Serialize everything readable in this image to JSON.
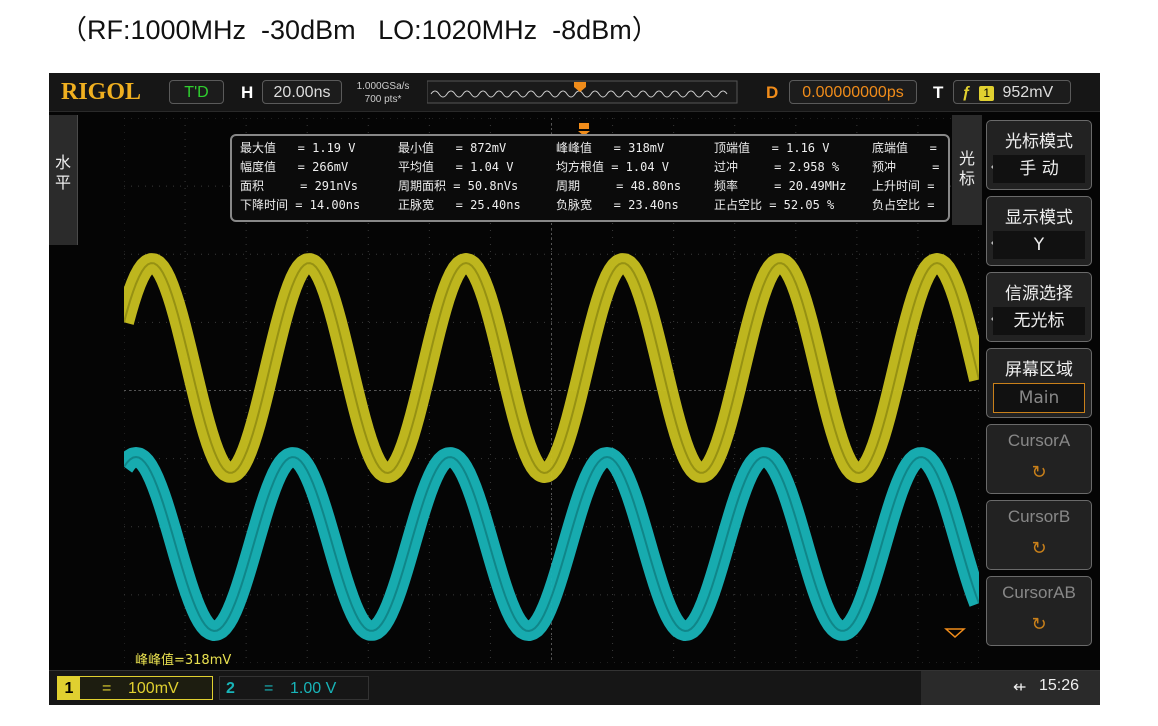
{
  "caption": "（RF:1000MHz  -30dBm   LO:1020MHz  -8dBm）",
  "topbar": {
    "brand": "RIGOL",
    "mode": "T'D",
    "h_label": "H",
    "timebase": "20.00ns",
    "sample_rate": "1.000GSa/s",
    "points": "700 pts*",
    "d_label": "D",
    "delay": "0.00000000ps",
    "t_label": "T",
    "trigger_channel": "1",
    "trigger_level": "952mV"
  },
  "left_panel": {
    "char1": "水",
    "char2": "平"
  },
  "right_tab": {
    "char1": "光",
    "char2": "标"
  },
  "menu": [
    {
      "title": "光标模式",
      "value": "手  动",
      "enabled": true
    },
    {
      "title": "显示模式",
      "value": "Y",
      "enabled": true
    },
    {
      "title": "信源选择",
      "value": "无光标",
      "enabled": true
    },
    {
      "title": "屏幕区域",
      "value": "Main",
      "enabled": true
    },
    {
      "title": "CursorA",
      "value": "↻",
      "enabled": false
    },
    {
      "title": "CursorB",
      "value": "↻",
      "enabled": false
    },
    {
      "title": "CursorAB",
      "value": "↻",
      "enabled": false
    }
  ],
  "measurements": [
    [
      "最大值   = 1.19 V",
      "最小值   = 872mV",
      "峰峰值   = 318mV",
      "顶端值   = 1.16 V",
      "底端值   ="
    ],
    [
      "幅度值   = 266mV",
      "平均值   = 1.04 V",
      "均方根值 = 1.04 V",
      "过冲     = 2.958 %",
      "预冲     ="
    ],
    [
      "面积     = 291nVs",
      "周期面积 = 50.8nVs",
      "周期     = 48.80ns",
      "频率     = 20.49MHz",
      "上升时间 ="
    ],
    [
      "下降时间 = 14.00ns",
      "正脉宽   = 25.40ns",
      "负脉宽   = 23.40ns",
      "正占空比 = 52.05 %",
      "负占空比 ="
    ]
  ],
  "pkpk_label": "峰峰值=318mV",
  "bottombar": {
    "ch1_num": "1",
    "ch1_coupling": "=",
    "ch1_scale": "100mV",
    "ch2_num": "2",
    "ch2_coupling": "=",
    "ch2_scale": "1.00 V",
    "time": "15:26"
  },
  "colors": {
    "ch1": "#c8c020",
    "ch2": "#18b4b8",
    "brand": "#f0b020",
    "accent": "#f08c1a"
  }
}
